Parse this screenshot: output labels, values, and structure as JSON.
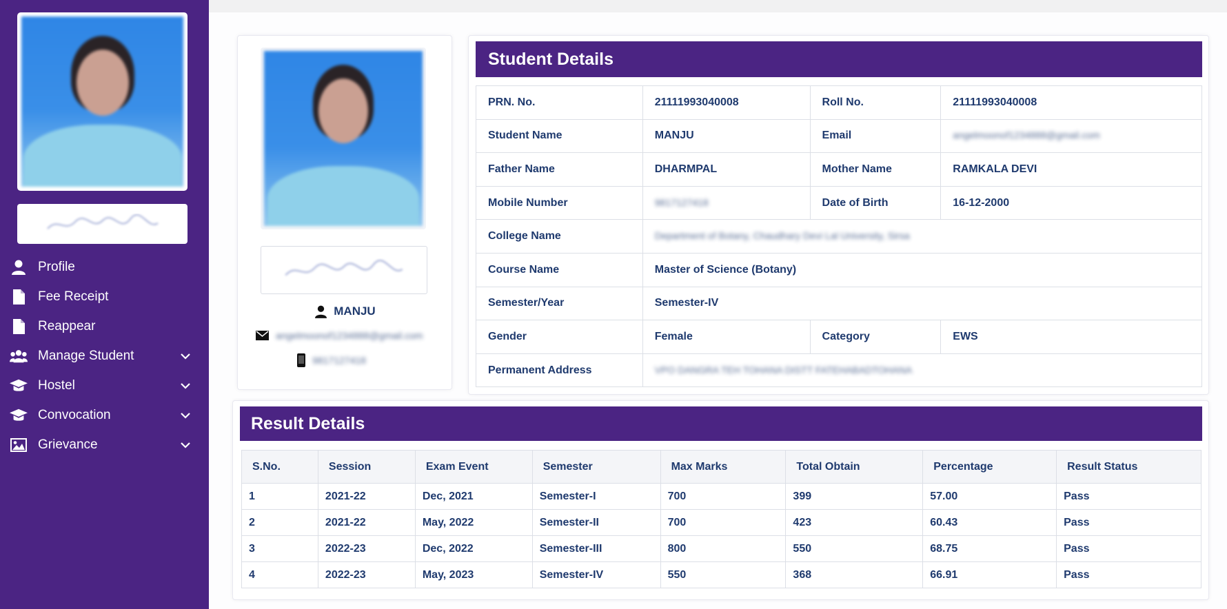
{
  "sidebar": {
    "items": [
      {
        "label": "Profile",
        "icon": "user-icon",
        "has_chevron": false
      },
      {
        "label": "Fee Receipt",
        "icon": "file-icon",
        "has_chevron": false
      },
      {
        "label": "Reappear",
        "icon": "file-icon",
        "has_chevron": false
      },
      {
        "label": "Manage Student",
        "icon": "users-icon",
        "has_chevron": true
      },
      {
        "label": "Hostel",
        "icon": "graduation-cap-icon",
        "has_chevron": true
      },
      {
        "label": "Convocation",
        "icon": "graduation-cap-icon",
        "has_chevron": true
      },
      {
        "label": "Grievance",
        "icon": "image-icon",
        "has_chevron": true
      }
    ]
  },
  "profile_card": {
    "name": "MANJU",
    "email": "angelmoonof1234888@gmail.com",
    "mobile": "9817127418"
  },
  "student_details": {
    "title": "Student Details",
    "rows": [
      {
        "l1": "PRN. No.",
        "v1": "21111993040008",
        "l2": "Roll No.",
        "v2": "21111993040008"
      },
      {
        "l1": "Student Name",
        "v1": "MANJU",
        "l2": "Email",
        "v2": "angelmoonof1234888@gmail.com"
      },
      {
        "l1": "Father Name",
        "v1": "DHARMPAL",
        "l2": "Mother Name",
        "v2": "RAMKALA DEVI"
      },
      {
        "l1": "Mobile Number",
        "v1": "9817127418",
        "l2": "Date of Birth",
        "v2": "16-12-2000"
      },
      {
        "l1": "College Name",
        "v1": "Department of Botany, Chaudhary Devi Lal University, Sirsa"
      },
      {
        "l1": "Course Name",
        "v1": "Master of Science (Botany)"
      },
      {
        "l1": "Semester/Year",
        "v1": "Semester-IV"
      },
      {
        "l1": "Gender",
        "v1": "Female",
        "l2": "Category",
        "v2": "EWS"
      },
      {
        "l1": "Permanent Address",
        "v1": "VPO DANGRA TEH TOHANA DISTT FATEHABADTOHANA"
      }
    ]
  },
  "result_details": {
    "title": "Result Details",
    "columns": [
      "S.No.",
      "Session",
      "Exam Event",
      "Semester",
      "Max Marks",
      "Total Obtain",
      "Percentage",
      "Result Status"
    ],
    "rows": [
      [
        "1",
        "2021-22",
        "Dec, 2021",
        "Semester-I",
        "700",
        "399",
        "57.00",
        "Pass"
      ],
      [
        "2",
        "2021-22",
        "May, 2022",
        "Semester-II",
        "700",
        "423",
        "60.43",
        "Pass"
      ],
      [
        "3",
        "2022-23",
        "Dec, 2022",
        "Semester-III",
        "800",
        "550",
        "68.75",
        "Pass"
      ],
      [
        "4",
        "2022-23",
        "May, 2023",
        "Semester-IV",
        "550",
        "368",
        "66.91",
        "Pass"
      ]
    ]
  },
  "colors": {
    "accent": "#4b2483",
    "text": "#1f3a6e"
  }
}
